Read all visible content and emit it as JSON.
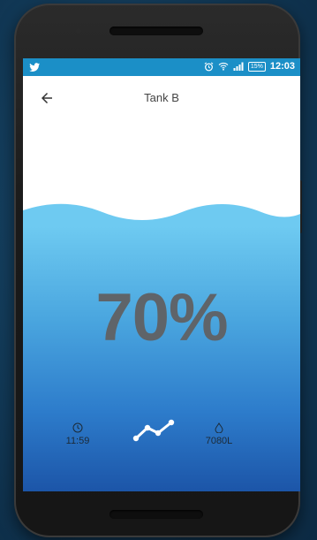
{
  "status_bar": {
    "time": "12:03",
    "battery": "15%",
    "icons": [
      "twitter-icon",
      "alarm-icon",
      "wifi-icon",
      "signal-icon",
      "battery-icon"
    ]
  },
  "app_bar": {
    "title": "Tank B",
    "back_icon": "arrow-left-icon"
  },
  "tank": {
    "fill_level_percent": 70,
    "level_label": "70%"
  },
  "stats": {
    "time": {
      "icon": "clock-icon",
      "value": "11:59"
    },
    "chart": {
      "icon": "line-chart-icon"
    },
    "volume": {
      "icon": "water-drop-icon",
      "value": "7080L"
    }
  },
  "colors": {
    "status_bar": "#1b8fc7",
    "water_top": "#6ecaf1",
    "water_bottom": "#1c55a8",
    "percent_text": "#5f6469"
  }
}
